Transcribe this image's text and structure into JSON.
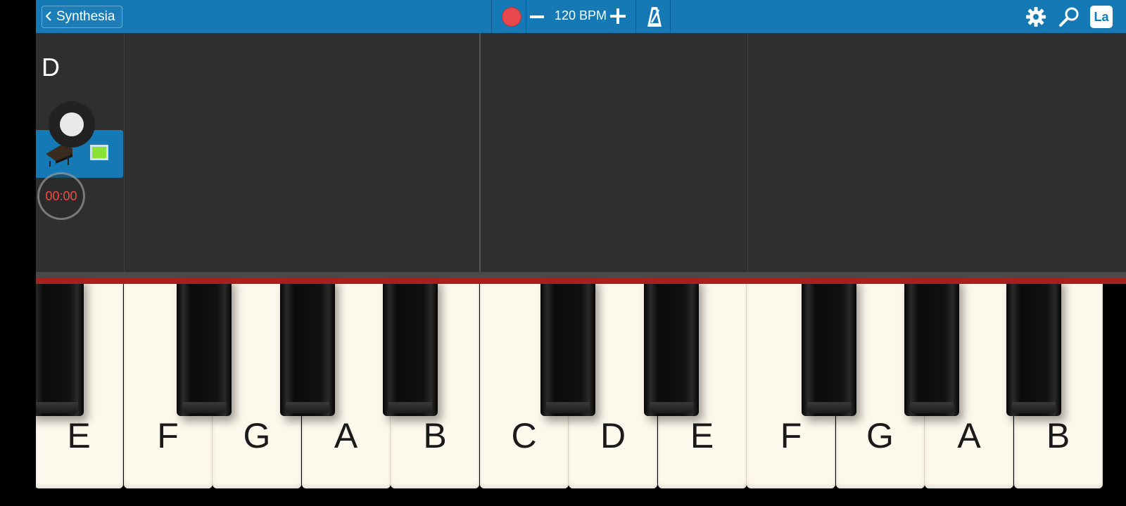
{
  "topbar": {
    "back_label": "Synthesia",
    "bpm_label": "120 BPM",
    "lang_label": "La",
    "accent_color": "#1479b5",
    "record_color": "#e8474c"
  },
  "track": {
    "key_label": "D",
    "timer": "00:00",
    "track_color": "#8ae234"
  },
  "keyboard": {
    "white_keys": [
      "E",
      "F",
      "G",
      "A",
      "B",
      "C",
      "D",
      "E",
      "F",
      "G",
      "A",
      "B"
    ]
  }
}
